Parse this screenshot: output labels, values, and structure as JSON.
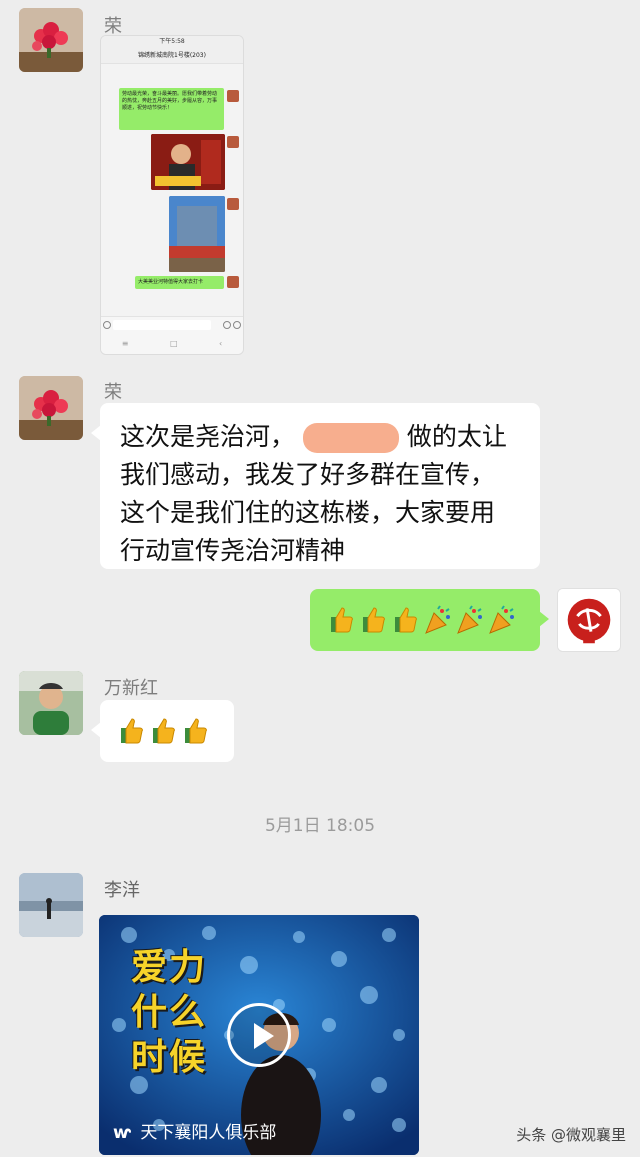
{
  "messages": [
    {
      "sender": "荣"
    },
    {
      "sender": "荣",
      "text_lines": [
        "这次是尧治河，",
        "做的太让",
        "我们感动，我发了好多群在宣传，",
        "这个是我们住的这栋楼，大家要用",
        "行动宣传尧治河精神"
      ]
    },
    {
      "sender": "",
      "text": "👍👍👍🎉🎉🎉"
    },
    {
      "sender": "万新红",
      "text": "👍👍👍"
    },
    {
      "sender": "李洋"
    }
  ],
  "timestamp": "5月1日 18:05",
  "embedded": {
    "status": "下午5:58",
    "title": "锦绣新城南院1号楼(203)",
    "msg1": "劳动最光荣，奋斗最美丽。愿我们带着劳动的热忱，奔赴五月的美好，步履从容，万事顺遂，祝劳动节快乐！",
    "msg2": "大美美业河特值得大家去打卡",
    "poster_text": "才全无法"
  },
  "video": {
    "title_lines": [
      "爱力",
      "什么",
      "时候"
    ],
    "caption": "天下襄阳人俱乐部"
  },
  "watermark": "头条 @微观襄里",
  "colors": {
    "green_bubble": "#95ec69",
    "background": "#ededed"
  }
}
